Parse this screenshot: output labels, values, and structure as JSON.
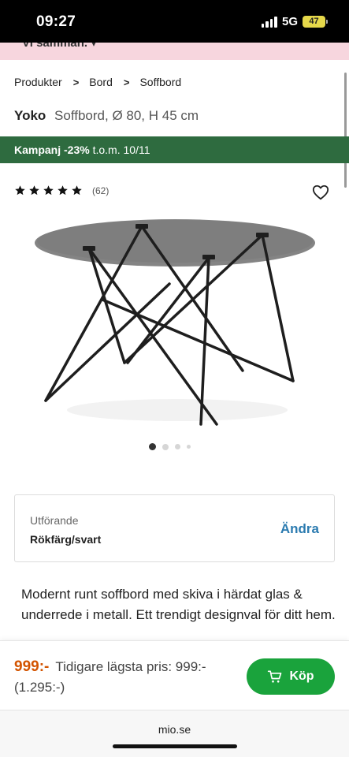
{
  "status_bar": {
    "time": "09:27",
    "network": "5G",
    "battery": "47"
  },
  "promo_strip": {
    "text": "Vi samman. ▾"
  },
  "breadcrumb": {
    "items": [
      "Produkter",
      "Bord",
      "Soffbord"
    ]
  },
  "product": {
    "name": "Yoko",
    "description": "Soffbord, Ø 80, H 45 cm"
  },
  "campaign": {
    "label": "Kampanj -23%",
    "period": "t.o.m. 10/11",
    "color": "#2e6b3f"
  },
  "rating": {
    "stars": 5,
    "count": "(62)"
  },
  "carousel": {
    "count": 4,
    "active": 0
  },
  "variant": {
    "label": "Utförande",
    "value": "Rökfärg/svart",
    "change_label": "Ändra"
  },
  "description": "Modernt runt soffbord med skiva i härdat glas & underrede i metall. Ett trendigt designval för ditt hem.",
  "buy_bar": {
    "price": "999:-",
    "previous_price": "Tidigare lägsta pris: 999:- (1.295:-)",
    "buy_label": "Köp",
    "price_color": "#d35400",
    "button_color": "#1aa33c"
  },
  "url": "mio.se"
}
